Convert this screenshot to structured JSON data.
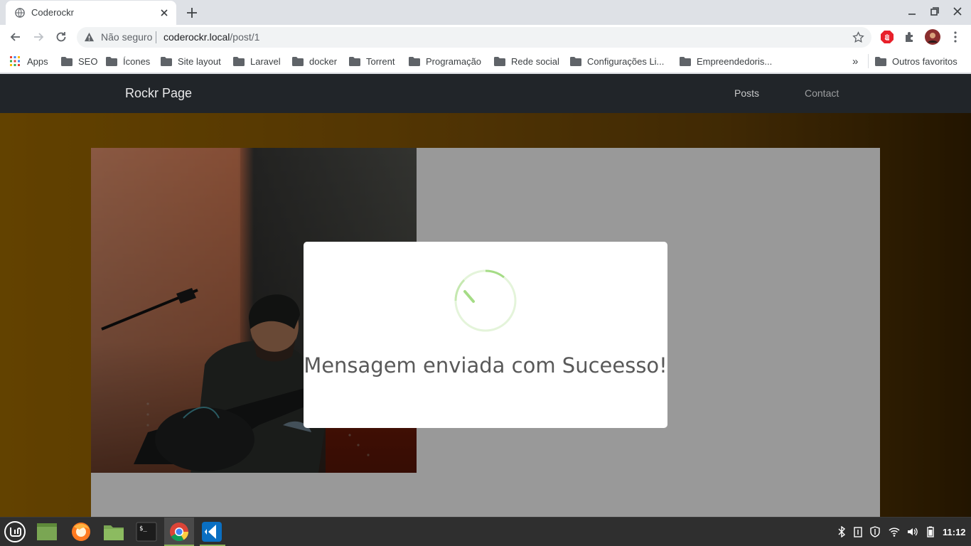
{
  "browser": {
    "tab_title": "Coderockr",
    "security_label": "Não seguro",
    "url_host": "coderockr.local",
    "url_path": "/post/1"
  },
  "bookmarks": [
    {
      "label": "Apps",
      "icon": "apps-grid-icon"
    },
    {
      "label": "SEO",
      "icon": "folder-icon"
    },
    {
      "label": "Ícones",
      "icon": "folder-icon"
    },
    {
      "label": "Site layout",
      "icon": "folder-icon"
    },
    {
      "label": "Laravel",
      "icon": "folder-icon"
    },
    {
      "label": "docker",
      "icon": "folder-icon"
    },
    {
      "label": "Torrent",
      "icon": "folder-icon"
    },
    {
      "label": "Programação",
      "icon": "folder-icon"
    },
    {
      "label": "Rede social",
      "icon": "folder-icon"
    },
    {
      "label": "Configurações Li...",
      "icon": "folder-icon"
    },
    {
      "label": "Empreendedoris...",
      "icon": "folder-icon"
    }
  ],
  "bookmarks_overflow": "»",
  "other_bookmarks": "Outros favoritos",
  "site": {
    "brand": "Rockr Page",
    "nav": [
      "Posts",
      "Contact"
    ]
  },
  "modal": {
    "message": "Mensagem enviada com Suceesso!",
    "spinner_color": "#a5dc86"
  },
  "taskbar": {
    "apps": [
      "linux-mint-menu-icon",
      "show-desktop-icon",
      "firefox-icon",
      "files-icon",
      "terminal-icon",
      "chrome-icon",
      "vscode-icon"
    ],
    "clock": "11:12"
  },
  "colors": {
    "navbar": "#212529",
    "page_gradient_start": "#a46e00",
    "page_gradient_end": "#3a2300"
  }
}
